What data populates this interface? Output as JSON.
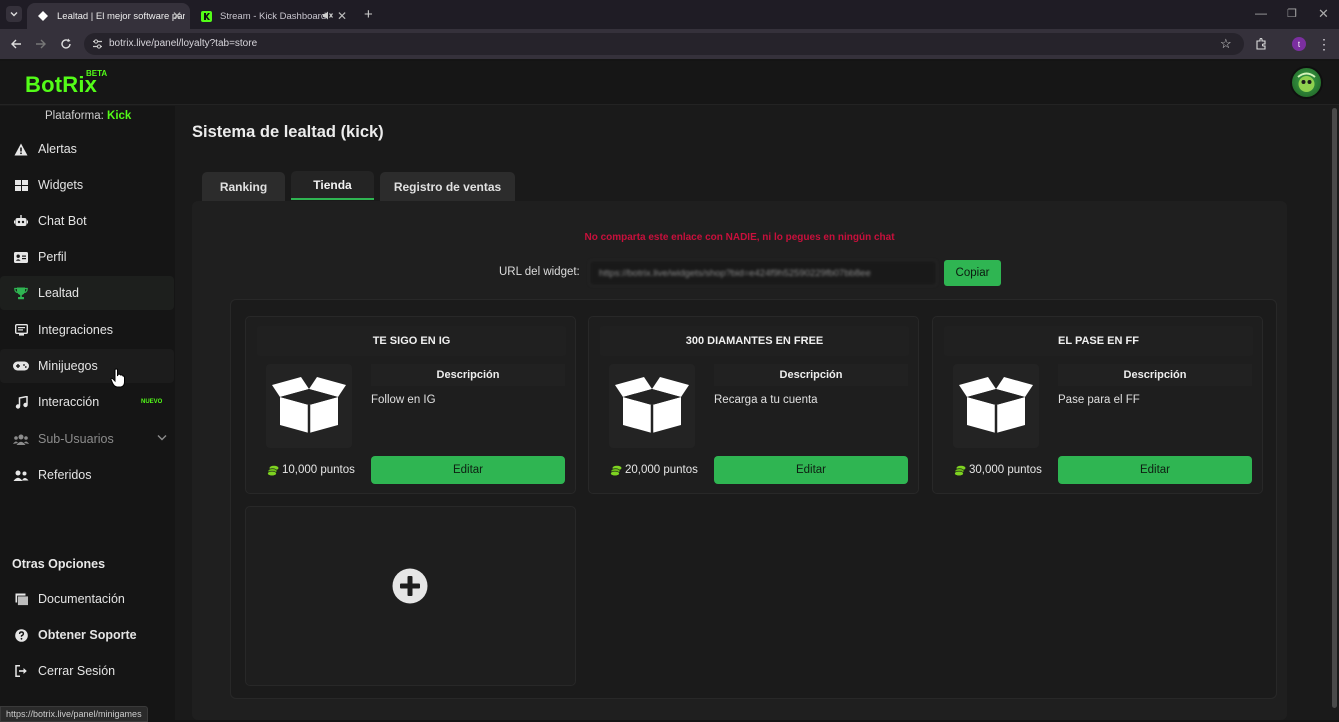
{
  "browser": {
    "tabs": [
      {
        "title": "Lealtad | El mejor software para",
        "active": true
      },
      {
        "title": "Stream - Kick Dashboard",
        "active": false
      }
    ],
    "url": "botrix.live/panel/loyalty?tab=store",
    "status_url": "https://botrix.live/panel/minigames"
  },
  "app": {
    "logo": "BotRix",
    "beta": "BETA",
    "platform_label": "Plataforma:",
    "platform_value": "Kick"
  },
  "sidebar": {
    "items": [
      {
        "label": "Alertas",
        "icon": "warning-icon"
      },
      {
        "label": "Widgets",
        "icon": "grid-icon"
      },
      {
        "label": "Chat Bot",
        "icon": "robot-icon"
      },
      {
        "label": "Perfil",
        "icon": "id-card-icon"
      },
      {
        "label": "Lealtad",
        "icon": "trophy-icon"
      },
      {
        "label": "Integraciones",
        "icon": "integration-icon"
      },
      {
        "label": "Minijuegos",
        "icon": "gamepad-icon"
      },
      {
        "label": "Interacción",
        "icon": "music-icon",
        "badge": "NUEVO"
      },
      {
        "label": "Sub-Usuarios",
        "icon": "users-icon"
      },
      {
        "label": "Referidos",
        "icon": "user-group-icon"
      }
    ],
    "others_title": "Otras Opciones",
    "others": [
      {
        "label": "Documentación",
        "icon": "document-icon"
      },
      {
        "label": "Obtener Soporte",
        "icon": "help-icon"
      },
      {
        "label": "Cerrar Sesión",
        "icon": "logout-icon"
      }
    ]
  },
  "main": {
    "title": "Sistema de lealtad (kick)",
    "tabs": [
      "Ranking",
      "Tienda",
      "Registro de ventas"
    ],
    "selected_tab": "Tienda",
    "warning": "No comparta este enlace con NADIE, ni lo pegues en ningún chat",
    "widget_url_label": "URL del widget:",
    "widget_url_value": "https://botrix.live/widgets/shop?bid=e424f9h52590229fb07bb8ee",
    "copy_label": "Copiar",
    "desc_header": "Descripción",
    "edit_label": "Editar",
    "items": [
      {
        "title": "TE SIGO EN IG",
        "description": "Follow en IG",
        "points": "10,000 puntos"
      },
      {
        "title": "300 DIAMANTES EN FREE",
        "description": "Recarga a tu cuenta",
        "points": "20,000 puntos"
      },
      {
        "title": "EL PASE EN FF",
        "description": "Pase para el FF",
        "points": "30,000 puntos"
      }
    ]
  },
  "colors": {
    "accent": "#53fc18",
    "button": "#2fb552",
    "warning": "#c8103c"
  }
}
